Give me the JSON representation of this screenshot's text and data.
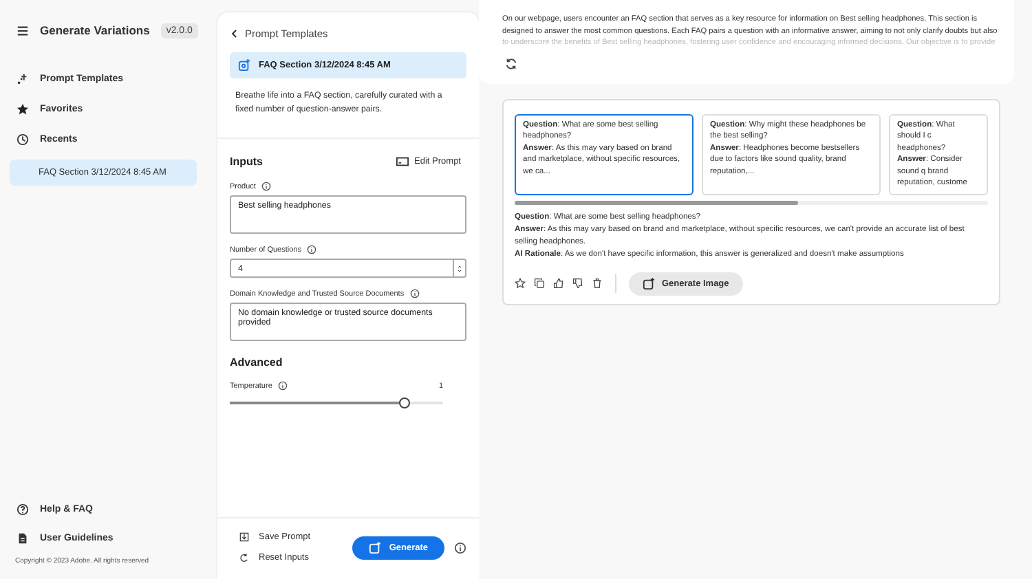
{
  "app": {
    "title": "Generate Variations",
    "version": "v2.0.0"
  },
  "sidebar": {
    "items": [
      {
        "label": "Prompt Templates",
        "kind": "templates"
      },
      {
        "label": "Favorites",
        "kind": "favorites"
      },
      {
        "label": "Recents",
        "kind": "recents"
      }
    ],
    "recents": [
      {
        "label": "FAQ Section 3/12/2024 8:45 AM",
        "selected": true
      }
    ],
    "footer_links": [
      {
        "label": "Help & FAQ",
        "kind": "help"
      },
      {
        "label": "User Guidelines",
        "kind": "guide"
      }
    ],
    "copyright": "Copyright © 2023 Adobe. All rights reserved"
  },
  "template": {
    "back": "Prompt Templates",
    "title": "FAQ Section 3/12/2024 8:45 AM",
    "description": "Breathe life into a FAQ section, carefully curated with a fixed number of question-answer pairs."
  },
  "inputs": {
    "heading": "Inputs",
    "edit_prompt": "Edit Prompt",
    "fields": [
      {
        "label": "Product",
        "value": "Best selling headphones",
        "kind": "textarea"
      },
      {
        "label": "Number of Questions",
        "value": "4",
        "kind": "number"
      },
      {
        "label": "Domain Knowledge and Trusted Source Documents",
        "value": "No domain knowledge or trusted source documents provided",
        "kind": "textarea"
      }
    ]
  },
  "advanced": {
    "heading": "Advanced",
    "temperature": {
      "label": "Temperature",
      "reading": "1",
      "level": 0.82
    }
  },
  "actions": {
    "save": "Save Prompt",
    "reset": "Reset Inputs",
    "generate": "Generate"
  },
  "result": {
    "summary": "On our webpage, users encounter an FAQ section that serves as a key resource for information on Best selling headphones. This section is designed to answer the most common questions. Each FAQ pairs a question with an informative answer, aiming to not only clarify doubts but also",
    "summary_faded": "to underscore the benefits of Best selling headphones, fostering user confidence and encouraging informed decisions. Our objective is to provide",
    "variations": [
      {
        "question": "**Question**: What are some best selling headphones?",
        "answer": "**Answer**: As this may vary based on brand and marketplace, without specific resources, we ca...",
        "selected": true
      },
      {
        "question": "**Question**: Why might these headphones be the best selling?",
        "answer": "**Answer**: Headphones become bestsellers due to factors like sound quality, brand reputation,...",
        "selected": false
      },
      {
        "question": "**Question**: What should I c headphones?",
        "answer": "**Answer**: Consider sound q brand reputation, custome",
        "selected": false
      }
    ],
    "detail": {
      "question": "**Question**: What are some best selling headphones?",
      "answer": "**Answer**: As this may vary based on brand and marketplace, without specific resources, we can't provide an accurate list of best selling headphones.",
      "rationale": "**AI Rationale**: As we don't have specific information, this answer is generalized and doesn't make assumptions"
    },
    "generate_image": "Generate Image"
  }
}
